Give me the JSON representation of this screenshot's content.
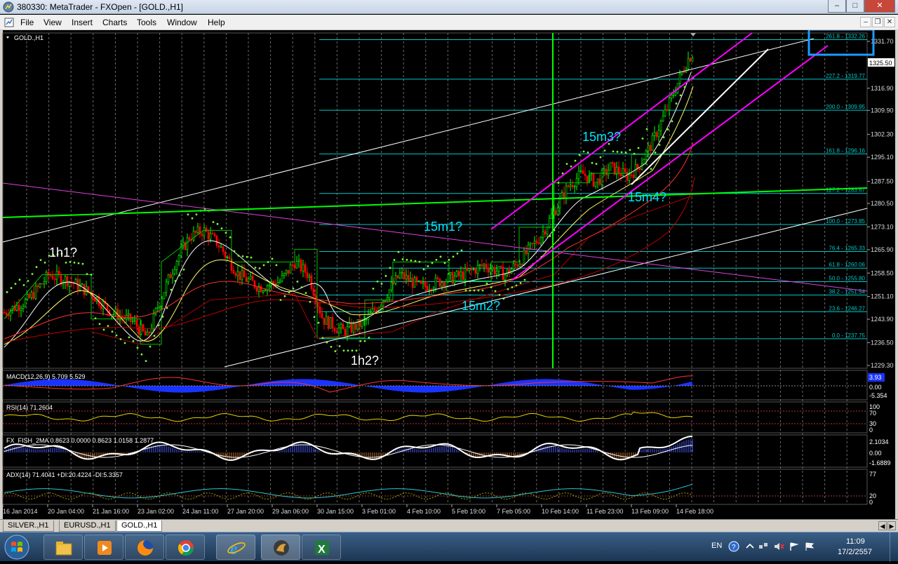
{
  "window": {
    "title": "380330: MetaTrader - FXOpen - [GOLD.,H1]"
  },
  "menu": {
    "items": [
      "File",
      "View",
      "Insert",
      "Charts",
      "Tools",
      "Window",
      "Help"
    ]
  },
  "chart": {
    "label": "GOLD.,H1",
    "current_price": "1325.50",
    "price_ticks": [
      "1331.70",
      "1316.90",
      "1309.90",
      "1302.30",
      "1295.10",
      "1287.50",
      "1280.50",
      "1273.10",
      "1265.90",
      "1258.50",
      "1251.10",
      "1243.90",
      "1236.50",
      "1229.30"
    ],
    "fib_levels": [
      {
        "label": "261.8 - 1332.26"
      },
      {
        "label": "227.2 - 1319.77"
      },
      {
        "label": "200.0 - 1309.95"
      },
      {
        "label": "161.8 - 1296.16"
      },
      {
        "label": "127.2 - 1283.67"
      },
      {
        "label": "100.0 - 1273.85"
      },
      {
        "label": "76.4 - 1265.33"
      },
      {
        "label": "61.8 - 1260.06"
      },
      {
        "label": "50.0 - 1255.80"
      },
      {
        "label": "38.2 - 1251.54"
      },
      {
        "label": "23.6 - 1246.27"
      },
      {
        "label": "0.0 - 1237.75"
      }
    ],
    "annotations": [
      "1h1?",
      "1h2?",
      "15m1?",
      "15m2?",
      "15m3?",
      "15m4?"
    ],
    "time_labels": [
      "16 Jan 2014",
      "20 Jan 04:00",
      "21 Jan 16:00",
      "23 Jan 02:00",
      "24 Jan 11:00",
      "27 Jan 20:00",
      "29 Jan 06:00",
      "30 Jan 15:00",
      "3 Feb 01:00",
      "4 Feb 10:00",
      "5 Feb 19:00",
      "7 Feb 05:00",
      "10 Feb 14:00",
      "11 Feb 23:00",
      "13 Feb 09:00",
      "14 Feb 18:00"
    ]
  },
  "indicators": {
    "macd": {
      "label": "MACD(12,26,9) 5.709 5.529",
      "ticks": [
        "3.93",
        "0.00",
        "-5.354"
      ]
    },
    "rsi": {
      "label": "RSI(14) 71.2604",
      "ticks": [
        "100",
        "70",
        "30",
        "0"
      ]
    },
    "fish": {
      "label": "FX_FISH_2MA 0.8623 0.0000 0.8623 1.0158 1.2877",
      "ticks": [
        "2.1034",
        "0.00",
        "-1.6889"
      ]
    },
    "adx": {
      "label": "ADX(14) 71.4041 +DI:20.4224 -DI:5.3357",
      "ticks": [
        "77",
        "20",
        "0"
      ]
    }
  },
  "tabs": [
    "SILVER.,H1",
    "EURUSD.,H1",
    "GOLD.,H1"
  ],
  "active_tab": "GOLD.,H1",
  "tray": {
    "language": "EN",
    "time": "11:09",
    "date": "17/2/2557"
  },
  "colors": {
    "bull": "#00ff00",
    "bear": "#ff0000",
    "fib": "#00c8c8",
    "pink": "#ff00ff",
    "annotation": "#00e5ff"
  }
}
